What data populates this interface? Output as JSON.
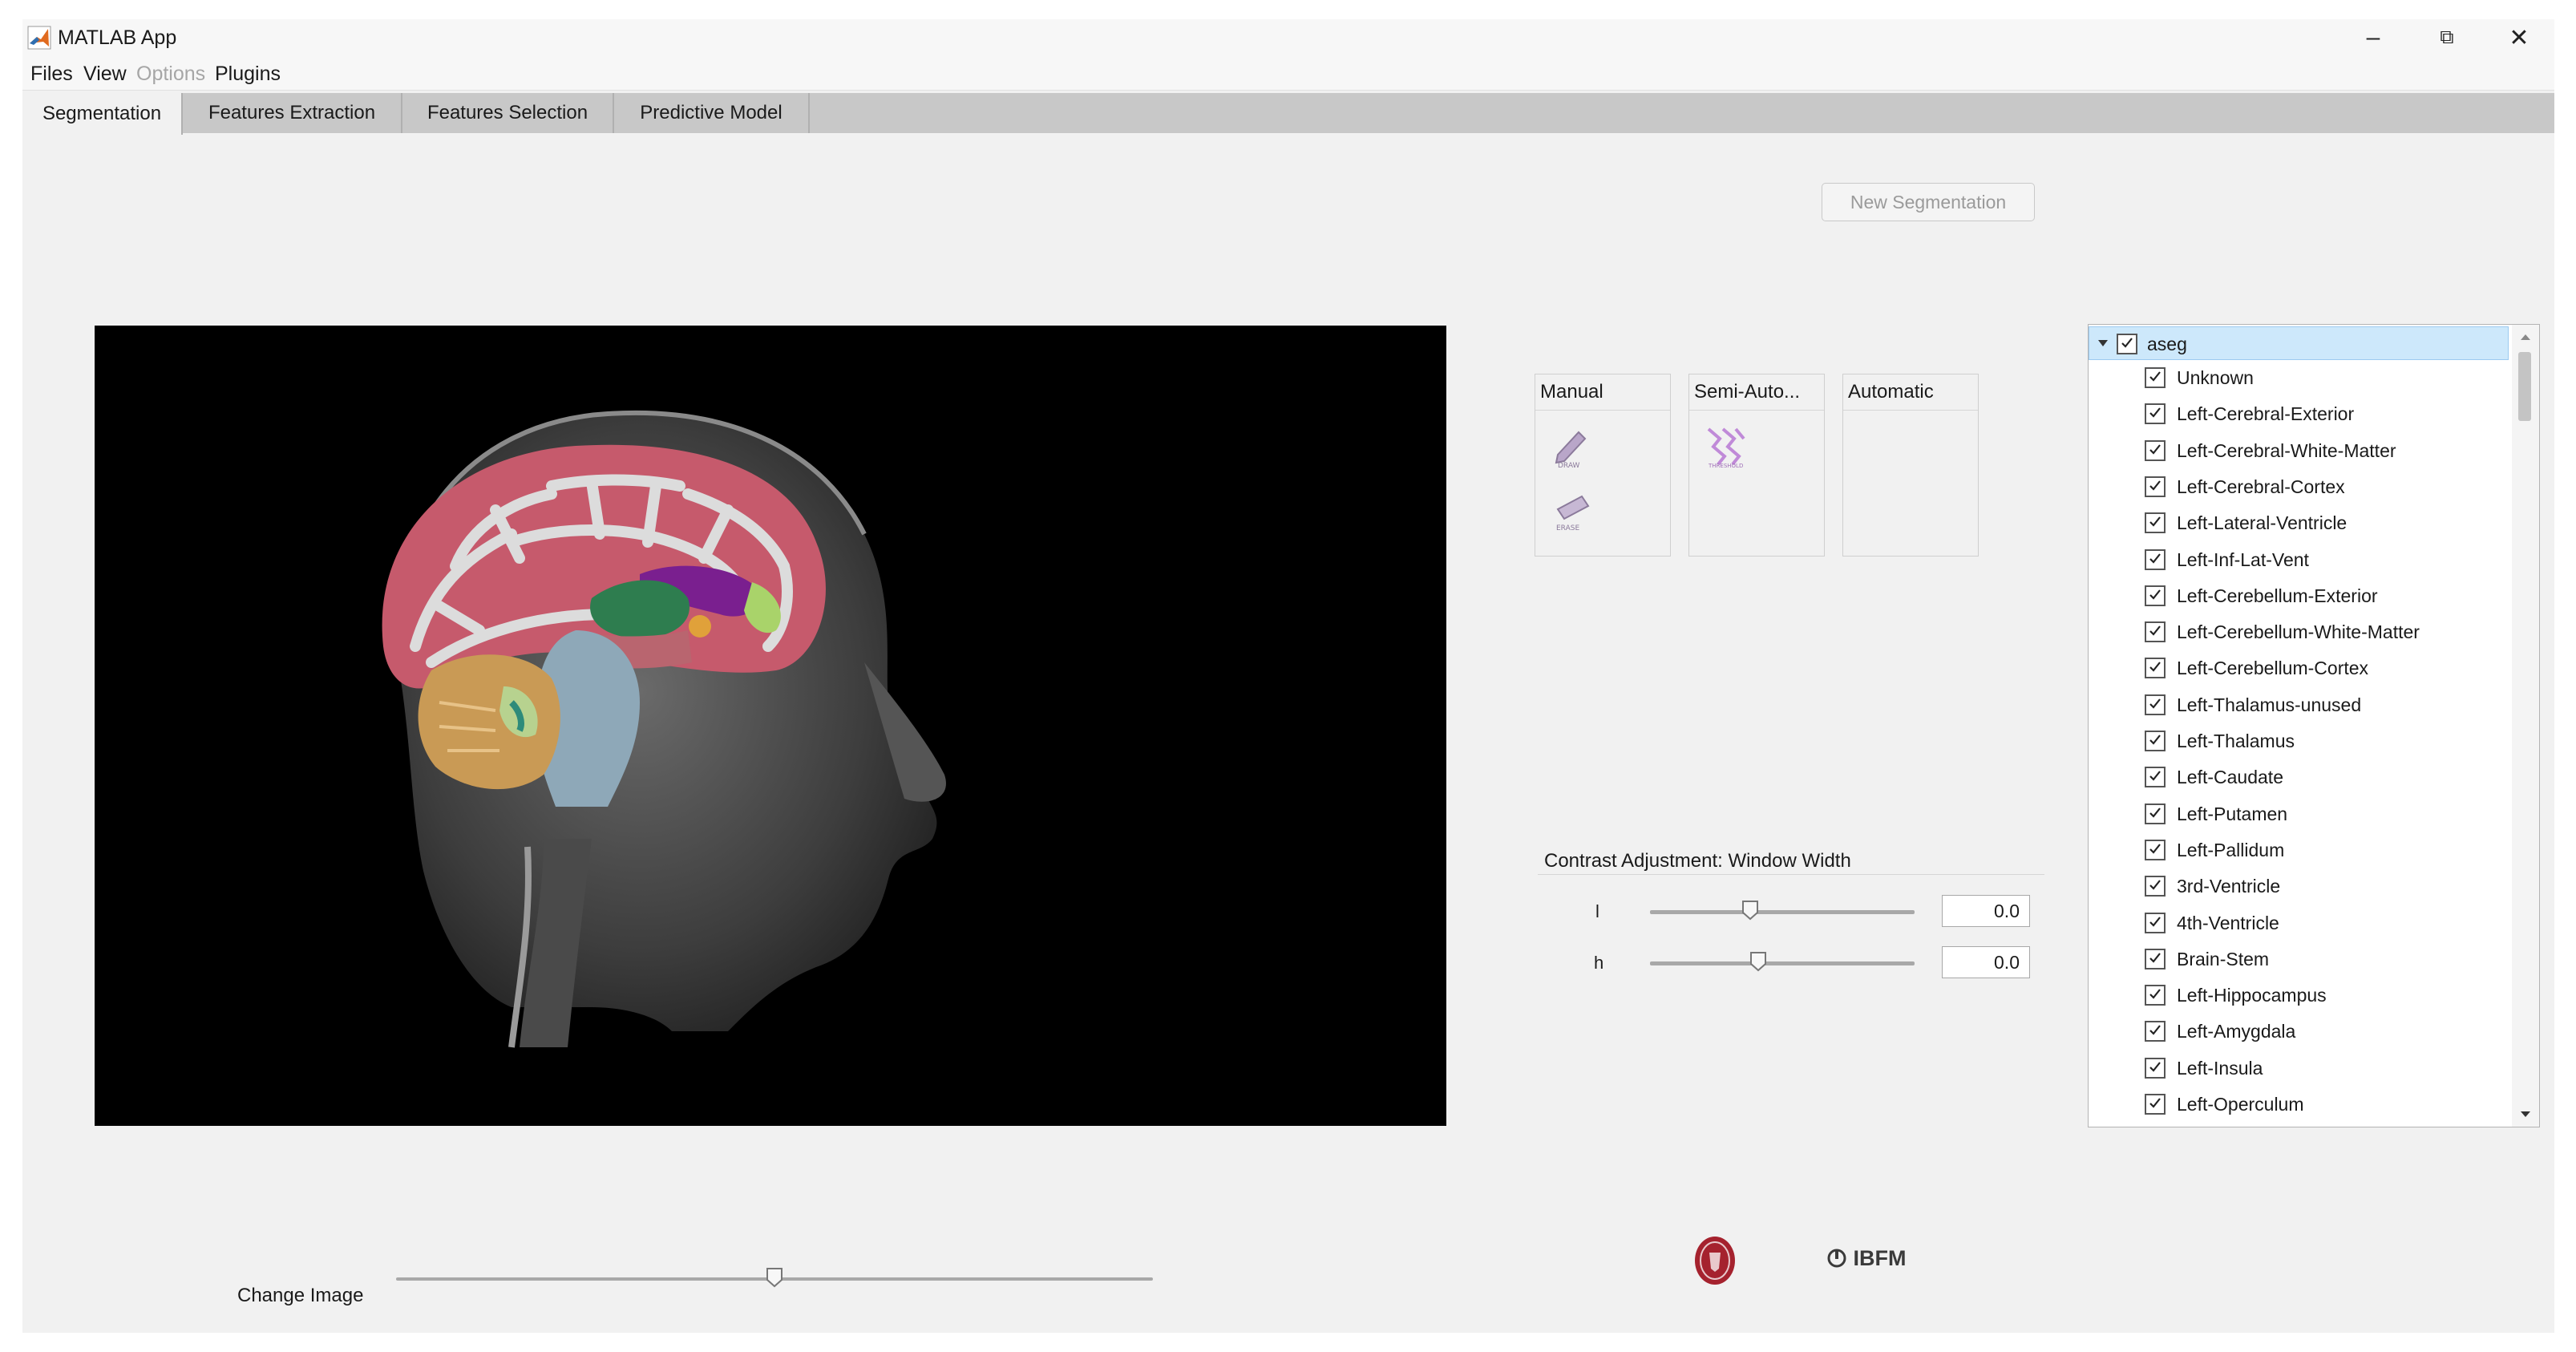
{
  "window": {
    "title": "MATLAB App"
  },
  "window_controls": {
    "minimize": "–",
    "restore": "⧉",
    "close": "✕"
  },
  "menu": {
    "files": "Files",
    "view": "View",
    "options": "Options",
    "plugins": "Plugins"
  },
  "tabs": [
    "Segmentation",
    "Features Extraction",
    "Features Selection",
    "Predictive Model"
  ],
  "buttons": {
    "new_segmentation": "New Segmentation"
  },
  "tools": {
    "manual": {
      "title": "Manual",
      "draw_label": "DRAW",
      "erase_label": "ERASE"
    },
    "semi_auto": {
      "title": "Semi-Auto...",
      "threshold_label": "THRESHOLD"
    },
    "automatic": {
      "title": "Automatic"
    }
  },
  "contrast": {
    "title": "Contrast Adjustment: Window Width",
    "low": {
      "label": "l",
      "value": "0.0",
      "position": 0.38
    },
    "high": {
      "label": "h",
      "value": "0.0",
      "position": 0.41
    }
  },
  "labels_tree": {
    "root": "aseg",
    "items": [
      "Unknown",
      "Left-Cerebral-Exterior",
      "Left-Cerebral-White-Matter",
      "Left-Cerebral-Cortex",
      "Left-Lateral-Ventricle",
      "Left-Inf-Lat-Vent",
      "Left-Cerebellum-Exterior",
      "Left-Cerebellum-White-Matter",
      "Left-Cerebellum-Cortex",
      "Left-Thalamus-unused",
      "Left-Thalamus",
      "Left-Caudate",
      "Left-Putamen",
      "Left-Pallidum",
      "3rd-Ventricle",
      "4th-Ventricle",
      "Brain-Stem",
      "Left-Hippocampus",
      "Left-Amygdala",
      "Left-Insula",
      "Left-Operculum"
    ]
  },
  "image_slider": {
    "label": "Change Image",
    "position": 0.5
  },
  "logos": {
    "ibfm": "IBFM"
  },
  "colors": {
    "tab_bar": "#c8c8c8",
    "selection": "#cde8fb",
    "cortex": "#c65a6c",
    "white_matter": "#d9d9d9",
    "cerebellum": "#c99a55",
    "brainstem": "#8ea8b8",
    "thalamus": "#2e7d4f",
    "ventricle": "#7a1f8f"
  }
}
